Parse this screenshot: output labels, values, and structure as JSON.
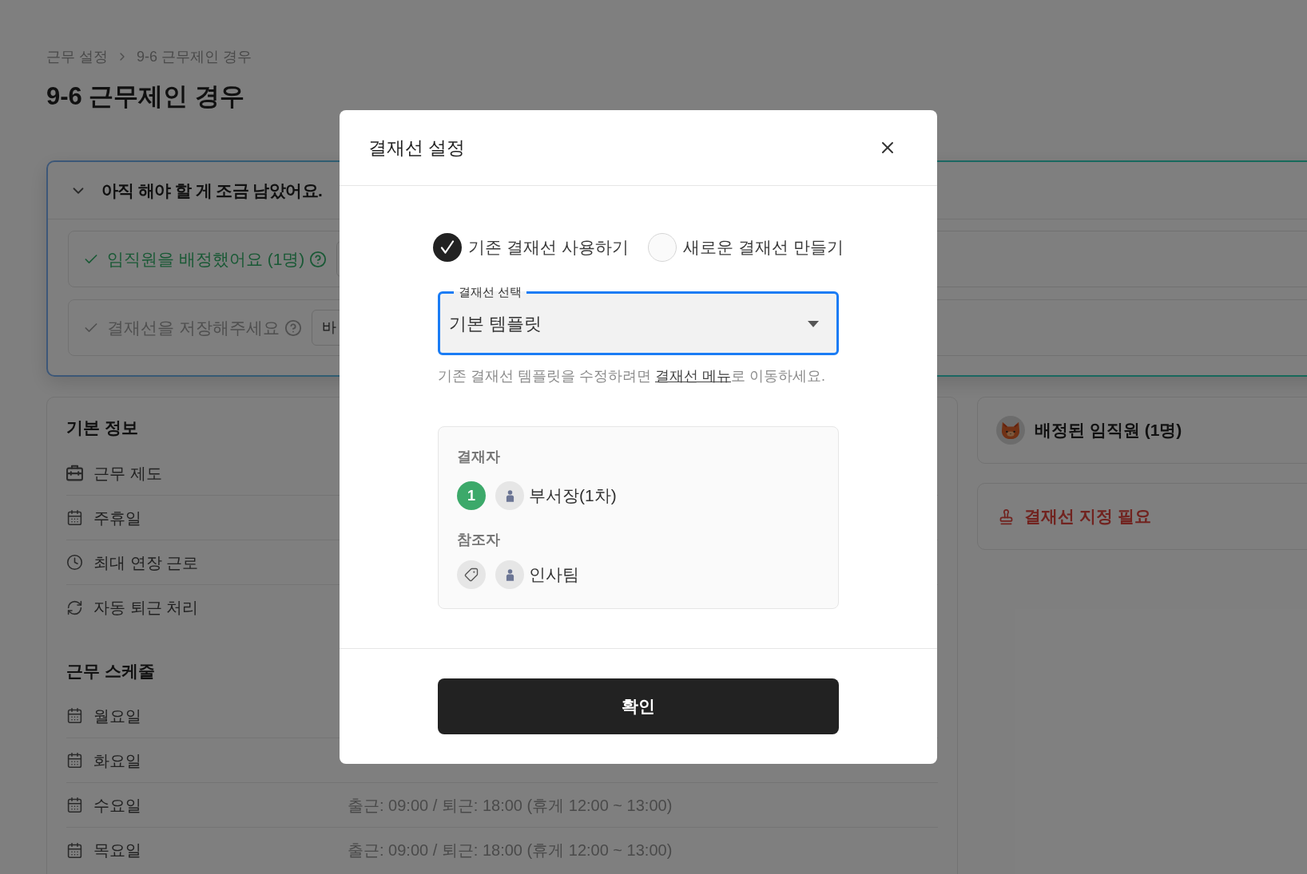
{
  "breadcrumb": [
    {
      "label": "근무 설정"
    },
    {
      "label": "9-6 근무제인 경우"
    }
  ],
  "page_title": "9-6 근무제인 경우",
  "checklist": {
    "title": "아직 해야 할 게 조금 남았어요.",
    "expanded": true,
    "items": [
      {
        "label": "임직원을 배정했어요 (1명)",
        "done": true
      },
      {
        "label": "결재선을 저장해주세요",
        "done": false,
        "button": "바"
      }
    ]
  },
  "basic_info": {
    "title": "기본 정보",
    "rows": [
      {
        "label": "근무 제도"
      },
      {
        "label": "주휴일"
      },
      {
        "label": "최대 연장 근로"
      },
      {
        "label": "자동 퇴근 처리"
      }
    ]
  },
  "schedule": {
    "title": "근무 스케줄",
    "rows": [
      {
        "day": "월요일"
      },
      {
        "day": "화요일"
      },
      {
        "day": "수요일",
        "hours": "출근: 09:00 / 퇴근: 18:00 (휴게 12:00 ~ 13:00)"
      },
      {
        "day": "목요일",
        "hours": "출근: 09:00 / 퇴근: 18:00 (휴게 12:00 ~ 13:00)"
      }
    ]
  },
  "side_cards": [
    {
      "kind": "employees",
      "label": "배정된 임직원 (1명)"
    },
    {
      "kind": "warning",
      "label": "결재선 지정 필요"
    }
  ],
  "modal": {
    "title": "결재선 설정",
    "options": [
      {
        "label": "기존 결재선 사용하기",
        "selected": true
      },
      {
        "label": "새로운 결재선 만들기",
        "selected": false
      }
    ],
    "select": {
      "label": "결재선 선택",
      "value": "기본 템플릿",
      "focused": true
    },
    "helper": {
      "before": "기존 결재선 템플릿을 수정하려면 ",
      "link": "결재선 메뉴",
      "after": "로 이동하세요."
    },
    "groups": [
      {
        "kind": "approver",
        "title": "결재자",
        "members": [
          {
            "order": "1",
            "name": "부서장(1차)"
          }
        ]
      },
      {
        "kind": "reference",
        "title": "참조자",
        "members": [
          {
            "name": "인사팀"
          }
        ]
      }
    ],
    "confirm": "확인"
  }
}
